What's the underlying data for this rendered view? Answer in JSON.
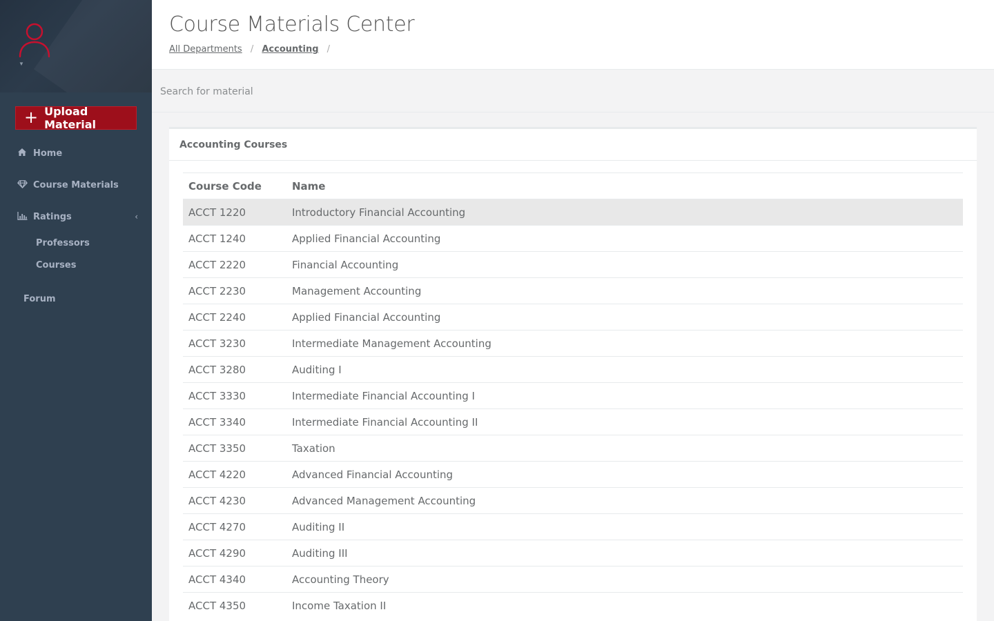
{
  "sidebar": {
    "upload_button": {
      "icon": "plus-icon",
      "label": "Upload Material"
    },
    "nav": {
      "home": {
        "icon": "home-icon",
        "label": "Home"
      },
      "course_materials": {
        "icon": "diamond-icon",
        "label": "Course Materials"
      },
      "ratings": {
        "icon": "bar-chart-icon",
        "label": "Ratings",
        "chevron": "‹"
      },
      "professors": {
        "label": "Professors"
      },
      "courses": {
        "label": "Courses"
      },
      "forum": {
        "label": "Forum"
      }
    },
    "profile": {
      "icon": "user-icon",
      "accent": "#c8102e"
    }
  },
  "header": {
    "title": "Course Materials Center",
    "breadcrumb": {
      "items": [
        "All Departments",
        "Accounting"
      ],
      "separator": "/"
    }
  },
  "search": {
    "placeholder": "Search for material"
  },
  "panel": {
    "title": "Accounting Courses",
    "columns": [
      "Course Code",
      "Name"
    ],
    "rows": [
      {
        "code": "ACCT 1220",
        "name": "Introductory Financial Accounting"
      },
      {
        "code": "ACCT 1240",
        "name": "Applied Financial Accounting"
      },
      {
        "code": "ACCT 2220",
        "name": "Financial Accounting"
      },
      {
        "code": "ACCT 2230",
        "name": "Management Accounting"
      },
      {
        "code": "ACCT 2240",
        "name": "Applied Financial Accounting"
      },
      {
        "code": "ACCT 3230",
        "name": "Intermediate Management Accounting"
      },
      {
        "code": "ACCT 3280",
        "name": "Auditing I"
      },
      {
        "code": "ACCT 3330",
        "name": "Intermediate Financial Accounting I"
      },
      {
        "code": "ACCT 3340",
        "name": "Intermediate Financial Accounting II"
      },
      {
        "code": "ACCT 3350",
        "name": "Taxation"
      },
      {
        "code": "ACCT 4220",
        "name": "Advanced Financial Accounting"
      },
      {
        "code": "ACCT 4230",
        "name": "Advanced Management Accounting"
      },
      {
        "code": "ACCT 4270",
        "name": "Auditing II"
      },
      {
        "code": "ACCT 4290",
        "name": "Auditing III"
      },
      {
        "code": "ACCT 4340",
        "name": "Accounting Theory"
      },
      {
        "code": "ACCT 4350",
        "name": "Income Taxation II"
      }
    ]
  },
  "colors": {
    "sidebar_bg": "#2f4050",
    "brand_red": "#9d0f1b",
    "row_highlight": "#e8e8e8"
  }
}
